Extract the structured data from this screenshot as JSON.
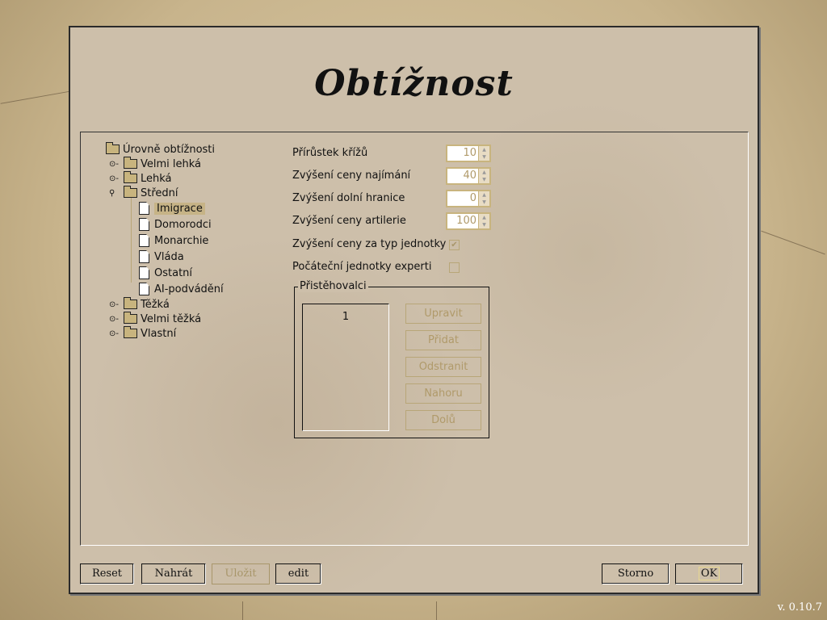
{
  "dialog": {
    "title": "Obtížnost"
  },
  "tree": {
    "root": "Úrovně obtížnosti",
    "levels": [
      "Velmi lehká",
      "Lehká",
      "Střední",
      "Těžká",
      "Velmi těžká",
      "Vlastní"
    ],
    "children": [
      "Imigrace",
      "Domorodci",
      "Monarchie",
      "Vláda",
      "Ostatní",
      "AI-podvádění"
    ],
    "selected": "Imigrace"
  },
  "options": {
    "spinners": [
      {
        "label": "Přírůstek křížů",
        "value": "10"
      },
      {
        "label": "Zvýšení ceny najímání",
        "value": "40"
      },
      {
        "label": "Zvýšení dolní hranice",
        "value": "0"
      },
      {
        "label": "Zvýšení ceny artilerie",
        "value": "100"
      }
    ],
    "checkboxes": [
      {
        "label": "Zvýšení ceny za typ jednotky",
        "checked": true
      },
      {
        "label": "Počáteční jednotky experti",
        "checked": false
      }
    ]
  },
  "immigrants": {
    "label": "Přistěhovalci",
    "items": [
      "1"
    ],
    "buttons": [
      "Upravit",
      "Přidat",
      "Odstranit",
      "Nahoru",
      "Dolů"
    ]
  },
  "footer": {
    "reset": "Reset",
    "load": "Nahrát",
    "save": "Uložit",
    "edit": "edit",
    "cancel": "Storno",
    "ok": "OK"
  },
  "version": "v. 0.10.7"
}
